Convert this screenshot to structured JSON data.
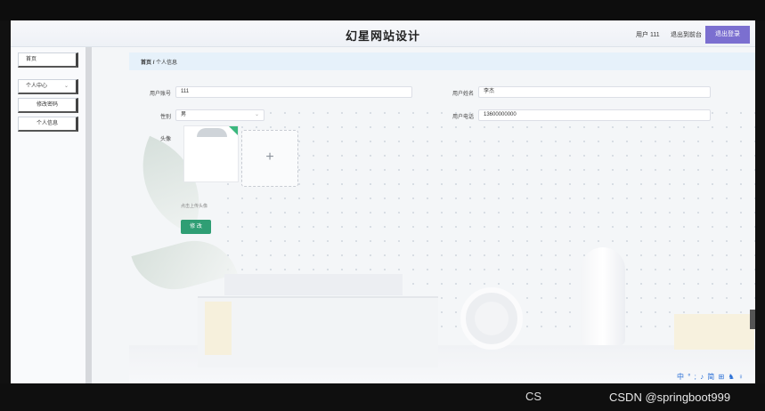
{
  "header": {
    "title": "幻星网站设计",
    "user": "用户 111",
    "back_label": "退出到前台",
    "logout_label": "退出登录"
  },
  "sidebar": {
    "items": [
      {
        "label": "首页"
      },
      {
        "label": "个人中心",
        "chevron": "⌄"
      },
      {
        "label": "修改密码"
      },
      {
        "label": "个人信息"
      }
    ]
  },
  "breadcrumb": {
    "home": "首页",
    "sep": "/",
    "current": "个人信息"
  },
  "form": {
    "account_label": "用户账号",
    "account_value": "111",
    "name_label": "用户姓名",
    "name_value": "李杰",
    "gender_label": "性别",
    "gender_value": "男",
    "phone_label": "用户电话",
    "phone_value": "13600000000",
    "avatar_label": "头像",
    "upload_plus": "+",
    "hint": "点击上传头像",
    "submit_label": "修 改"
  },
  "overlay": {
    "watermark_left": "CS",
    "watermark_right": "CSDN @springboot999",
    "tray_icons": "中 ° ; ♪ 简 ⊞ ♞ ♀"
  }
}
